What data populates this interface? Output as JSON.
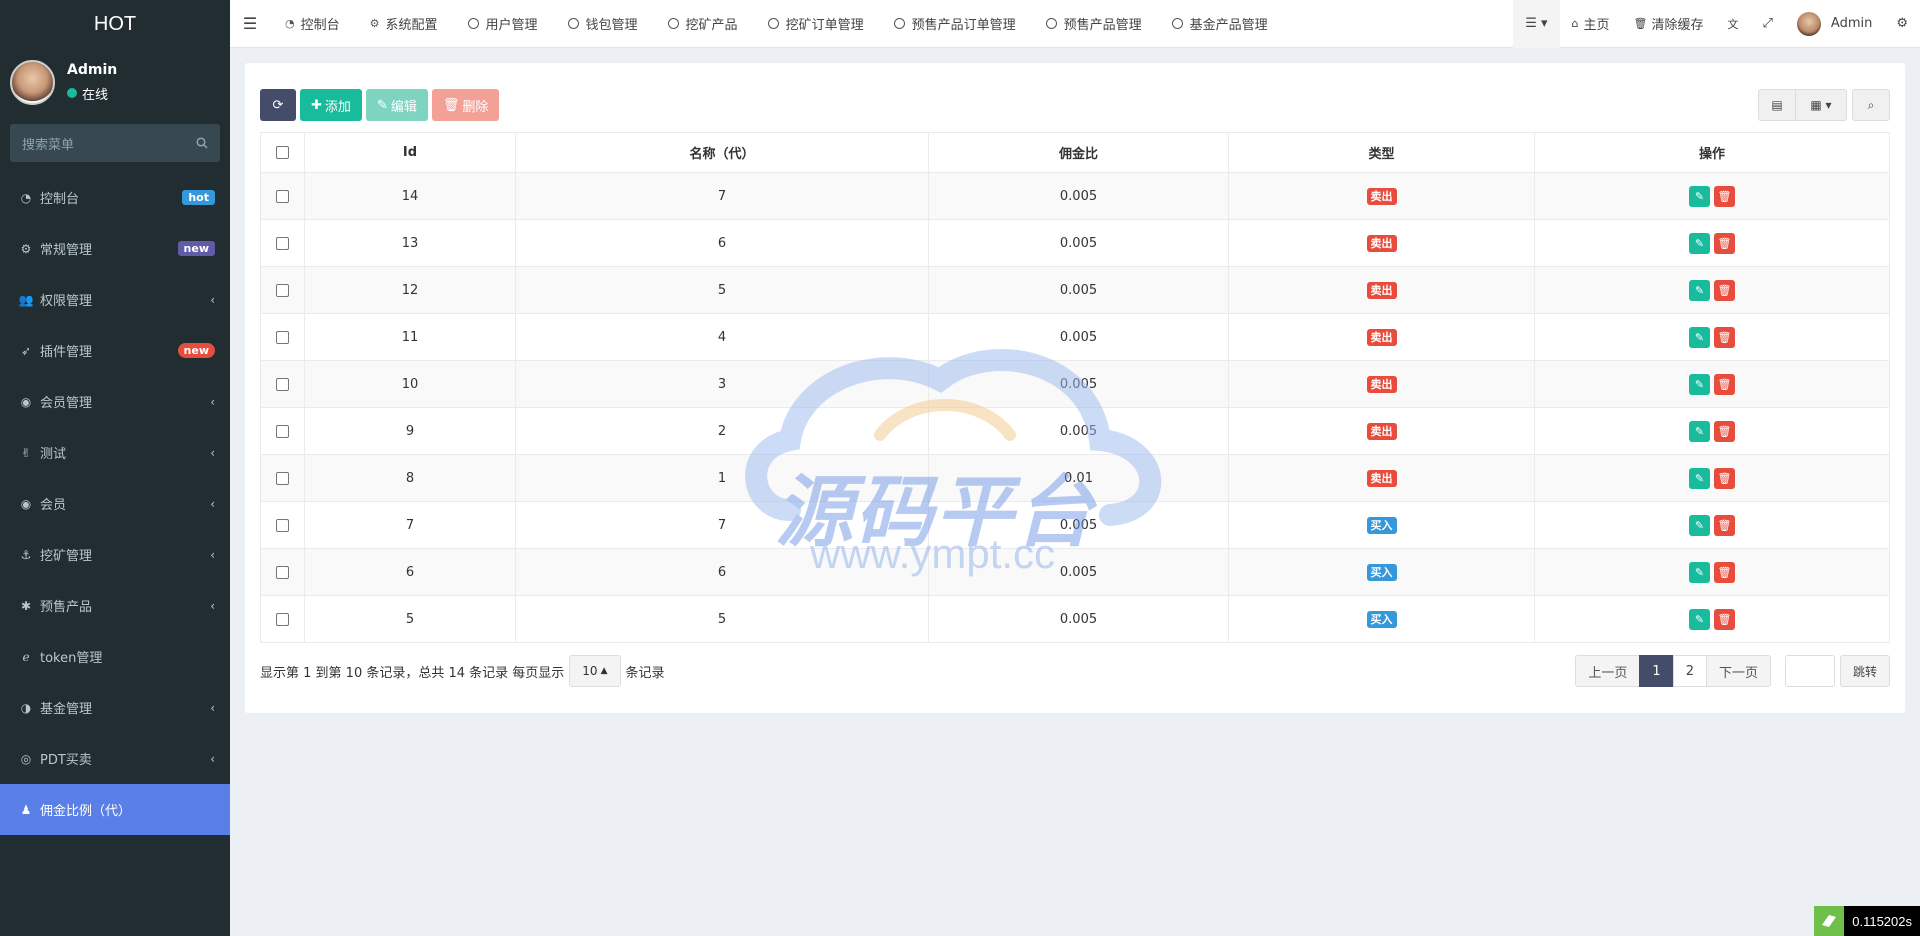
{
  "brand": "HOT",
  "user": {
    "name": "Admin",
    "status": "在线"
  },
  "search_placeholder": "搜索菜单",
  "menu": [
    {
      "label": "控制台",
      "icon": "dashboard-icon",
      "badge": "hot",
      "badge_color": "blue"
    },
    {
      "label": "常规管理",
      "icon": "cogs-icon",
      "badge": "new",
      "badge_color": "purple"
    },
    {
      "label": "权限管理",
      "icon": "group-icon",
      "chevron": "‹"
    },
    {
      "label": "插件管理",
      "icon": "rocket-icon",
      "badge": "new",
      "badge_color": "red"
    },
    {
      "label": "会员管理",
      "icon": "user-circle-icon",
      "chevron": "‹"
    },
    {
      "label": "测试",
      "icon": "hand-icon",
      "chevron": "‹"
    },
    {
      "label": "会员",
      "icon": "user-circle-icon",
      "chevron": "‹"
    },
    {
      "label": "挖矿管理",
      "icon": "anchor-icon",
      "chevron": "‹"
    },
    {
      "label": "预售产品",
      "icon": "yelp-icon",
      "chevron": "‹"
    },
    {
      "label": "token管理",
      "icon": "internet-explorer-icon"
    },
    {
      "label": "基金管理",
      "icon": "adjust-icon",
      "chevron": "‹"
    },
    {
      "label": "PDT买卖",
      "icon": "compass-icon",
      "chevron": "‹"
    },
    {
      "label": "佣金比例（代）",
      "icon": "child-icon",
      "active": true
    }
  ],
  "tabs": [
    {
      "label": "控制台",
      "icon": "dashboard-icon"
    },
    {
      "label": "系统配置",
      "icon": "gear-icon"
    },
    {
      "label": "用户管理",
      "icon": "circle-icon"
    },
    {
      "label": "钱包管理",
      "icon": "circle-icon"
    },
    {
      "label": "挖矿产品",
      "icon": "circle-icon"
    },
    {
      "label": "挖矿订单管理",
      "icon": "circle-icon"
    },
    {
      "label": "预售产品订单管理",
      "icon": "circle-icon"
    },
    {
      "label": "预售产品管理",
      "icon": "circle-icon"
    },
    {
      "label": "基金产品管理",
      "icon": "circle-icon"
    }
  ],
  "right_nav": {
    "home": "主页",
    "clear_cache": "清除缓存",
    "admin": "Admin"
  },
  "toolbar": {
    "add": "添加",
    "edit": "编辑",
    "delete": "删除"
  },
  "table": {
    "headers": [
      "Id",
      "名称（代）",
      "佣金比",
      "类型",
      "操作"
    ],
    "rows": [
      {
        "id": "14",
        "name": "7",
        "ratio": "0.005",
        "type": "卖出"
      },
      {
        "id": "13",
        "name": "6",
        "ratio": "0.005",
        "type": "卖出"
      },
      {
        "id": "12",
        "name": "5",
        "ratio": "0.005",
        "type": "卖出"
      },
      {
        "id": "11",
        "name": "4",
        "ratio": "0.005",
        "type": "卖出"
      },
      {
        "id": "10",
        "name": "3",
        "ratio": "0.005",
        "type": "卖出"
      },
      {
        "id": "9",
        "name": "2",
        "ratio": "0.005",
        "type": "卖出"
      },
      {
        "id": "8",
        "name": "1",
        "ratio": "0.01",
        "type": "卖出"
      },
      {
        "id": "7",
        "name": "7",
        "ratio": "0.005",
        "type": "买入"
      },
      {
        "id": "6",
        "name": "6",
        "ratio": "0.005",
        "type": "买入"
      },
      {
        "id": "5",
        "name": "5",
        "ratio": "0.005",
        "type": "买入"
      }
    ]
  },
  "footer": {
    "summary": "显示第 1 到第 10 条记录，总共 14 条记录 每页显示",
    "page_size": "10",
    "suffix": "条记录"
  },
  "pager": {
    "prev": "上一页",
    "pages": [
      "1",
      "2"
    ],
    "next": "下一页",
    "go": "跳转"
  },
  "watermark": {
    "text": "源码平台",
    "url": "www.ympt.cc"
  },
  "timer": "0.115202s",
  "colors": {
    "sidebar": "#222d32",
    "active": "#5a7fe6",
    "green": "#18bc9c",
    "red": "#e74c3c",
    "blue": "#3498db",
    "dark": "#444c69"
  }
}
